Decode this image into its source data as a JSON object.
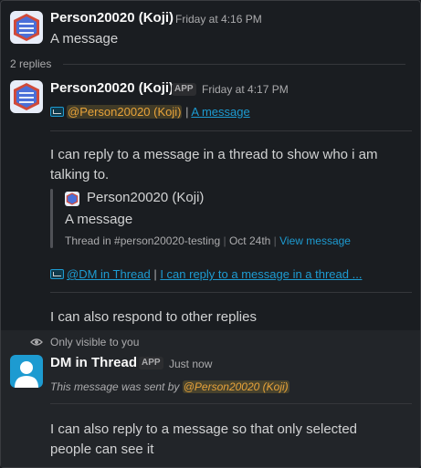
{
  "messages": [
    {
      "author": "Person20020 (Koji)",
      "time": "Friday at 4:16 PM",
      "text": "A message"
    }
  ],
  "thread": {
    "replies_label": "2 replies"
  },
  "reply1": {
    "author": "Person20020 (Koji)",
    "app_badge": "APP",
    "time": "Friday at 4:17 PM",
    "ref_mention": "@Person20020 (Koji)",
    "ref_sep": " | ",
    "ref_link": "A message",
    "text": "I can reply to a message in a thread to show who i am talking to.",
    "quote": {
      "author": "Person20020 (Koji)",
      "text": "A message",
      "thread_in": "Thread in",
      "channel_hash": "#",
      "channel": "person20020-testing",
      "sep": "|",
      "date": "Oct 24th",
      "view_link": "View message"
    },
    "ref2_mention": "@DM in Thread",
    "ref2_sep": " | ",
    "ref2_link": "I can reply to a message in a thread ...",
    "text2": "I can also respond to other replies"
  },
  "ephemeral": {
    "notice": "Only visible to you",
    "author": "DM in Thread",
    "app_badge": "APP",
    "time": "Just now",
    "sent_by_prefix": "This message was sent by",
    "sent_by_mention": "@Person20020 (Koji)",
    "text": "I can also reply to a message so that only selected people can see it"
  },
  "colors": {
    "background": "#1a1d21",
    "link": "#1d9bd1",
    "mention": "#e8a33a",
    "avatar_blue": "#4a6fd8",
    "avatar_red": "#d04a3a",
    "default_avatar": "#1d9bd1"
  }
}
